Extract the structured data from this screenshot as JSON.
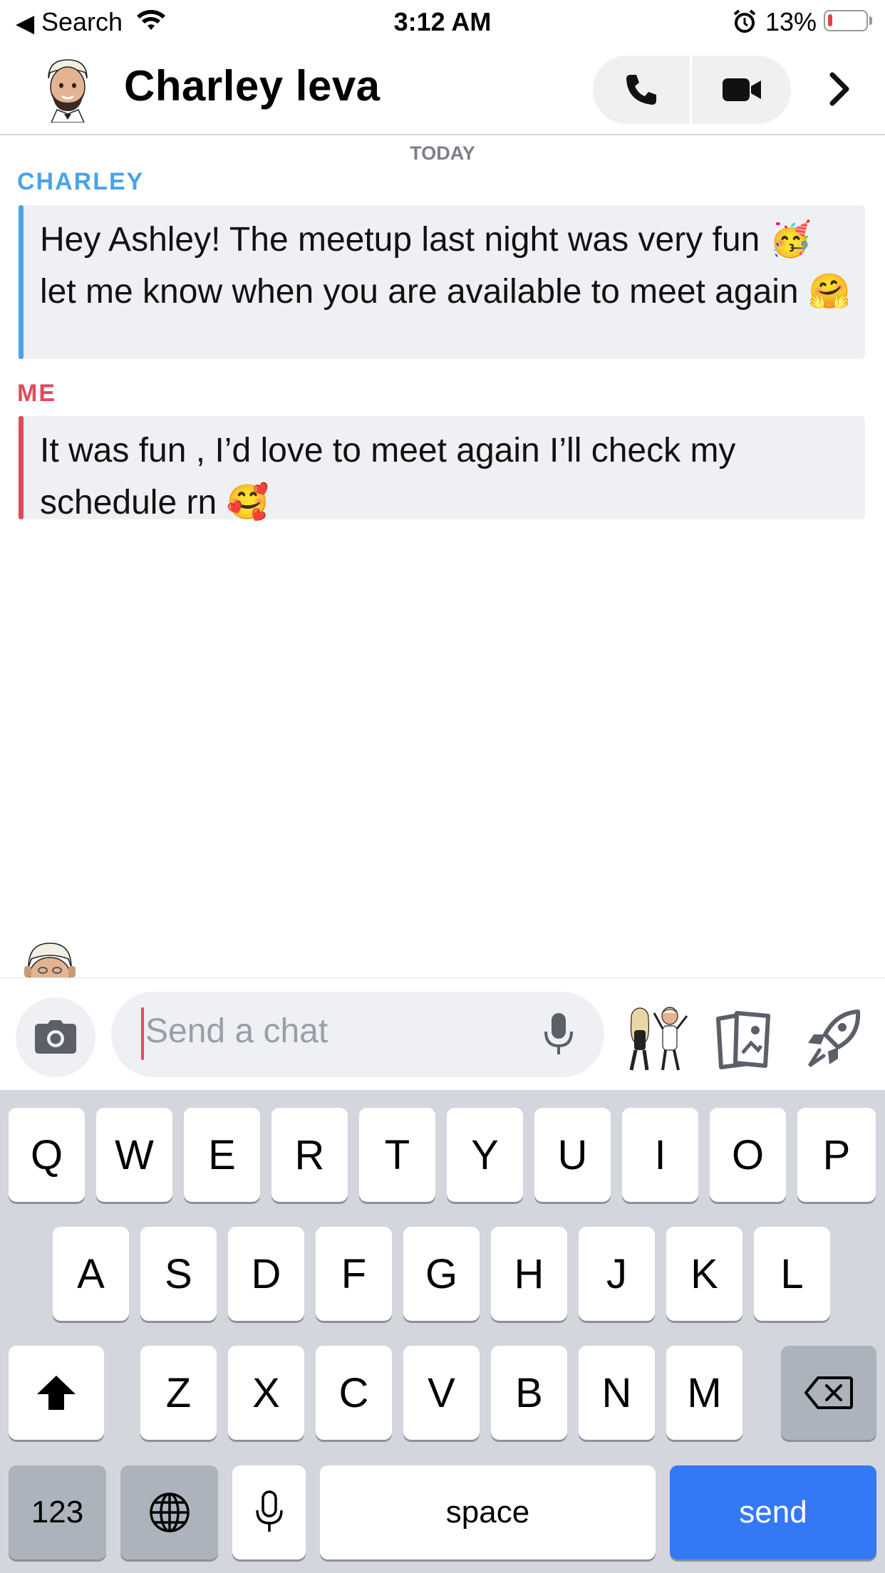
{
  "status_bar": {
    "back_label": "Search",
    "time": "3:12 AM",
    "battery_percent": "13%",
    "battery_level": 0.13
  },
  "header": {
    "contact_name": "Charley leva"
  },
  "chat": {
    "date_label": "TODAY",
    "messages": [
      {
        "sender": "CHARLEY",
        "text": "Hey Ashley! The meetup last night was very fun 🥳 let me know when you are available to meet again 🤗",
        "color": "#4aa3e8"
      },
      {
        "sender": "ME",
        "text": "It was fun , I’d love to meet again I’ll check my schedule rn 🥰",
        "color": "#e04a5c"
      }
    ]
  },
  "input": {
    "placeholder": "Send a chat"
  },
  "keyboard": {
    "row1": [
      "Q",
      "W",
      "E",
      "R",
      "T",
      "Y",
      "U",
      "I",
      "O",
      "P"
    ],
    "row2": [
      "A",
      "S",
      "D",
      "F",
      "G",
      "H",
      "J",
      "K",
      "L"
    ],
    "row3": [
      "Z",
      "X",
      "C",
      "V",
      "B",
      "N",
      "M"
    ],
    "numbers_key": "123",
    "space_key": "space",
    "send_key": "send"
  },
  "colors": {
    "accent_blue": "#3478f6",
    "charley_color": "#4aa3e8",
    "me_color": "#e04a5c"
  },
  "icons": [
    "back-arrow-icon",
    "wifi-icon",
    "alarm-icon",
    "battery-icon",
    "phone-icon",
    "video-camera-icon",
    "chevron-right-icon",
    "camera-icon",
    "microphone-icon",
    "bitmoji-icon",
    "cards-icon",
    "rocket-icon",
    "shift-icon",
    "backspace-icon",
    "globe-icon"
  ]
}
